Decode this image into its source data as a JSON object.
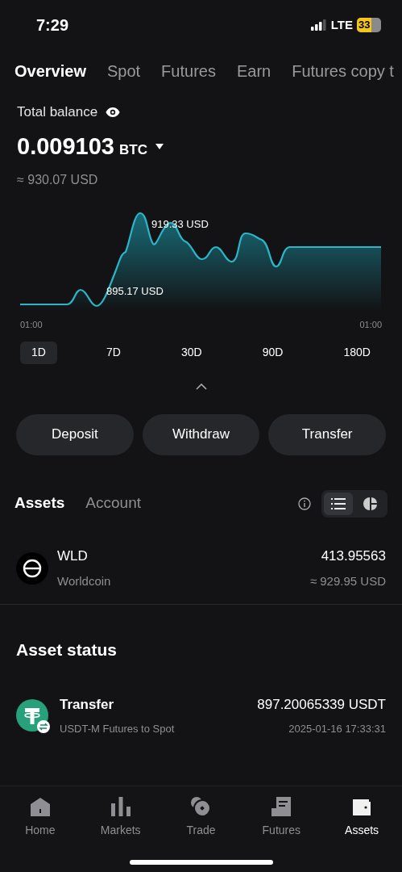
{
  "status_bar": {
    "time": "7:29",
    "network": "LTE",
    "battery": "33"
  },
  "tabs": [
    {
      "label": "Overview",
      "selected": true
    },
    {
      "label": "Spot",
      "selected": false
    },
    {
      "label": "Futures",
      "selected": false
    },
    {
      "label": "Earn",
      "selected": false
    },
    {
      "label": "Futures copy t",
      "selected": false
    }
  ],
  "balance": {
    "label": "Total balance",
    "amount": "0.009103",
    "currency": "BTC",
    "approx": "≈ 930.07 USD"
  },
  "chart": {
    "high_label": "919.33 USD",
    "low_label": "895.17 USD",
    "x_start": "01:00",
    "x_end": "01:00"
  },
  "ranges": [
    {
      "label": "1D",
      "selected": true
    },
    {
      "label": "7D",
      "selected": false
    },
    {
      "label": "30D",
      "selected": false
    },
    {
      "label": "90D",
      "selected": false
    },
    {
      "label": "180D",
      "selected": false
    }
  ],
  "actions": [
    "Deposit",
    "Withdraw",
    "Transfer"
  ],
  "asset_tabs": [
    {
      "label": "Assets",
      "selected": true
    },
    {
      "label": "Account",
      "selected": false
    }
  ],
  "view_toggle": [
    {
      "kind": "list",
      "selected": true
    },
    {
      "kind": "pie",
      "selected": false
    }
  ],
  "assets": [
    {
      "symbol": "WLD",
      "name": "Worldcoin",
      "amount": "413.95563",
      "value": "≈ 929.95 USD"
    }
  ],
  "asset_status": {
    "title": "Asset status",
    "items": [
      {
        "title": "Transfer",
        "subtitle": "USDT-M Futures to Spot",
        "amount": "897.20065339 USDT",
        "time": "2025-01-16 17:33:31"
      }
    ]
  },
  "nav": [
    {
      "label": "Home",
      "kind": "home",
      "selected": false
    },
    {
      "label": "Markets",
      "kind": "markets",
      "selected": false
    },
    {
      "label": "Trade",
      "kind": "trade",
      "selected": false
    },
    {
      "label": "Futures",
      "kind": "futures",
      "selected": false
    },
    {
      "label": "Assets",
      "kind": "assets",
      "selected": true
    }
  ]
}
